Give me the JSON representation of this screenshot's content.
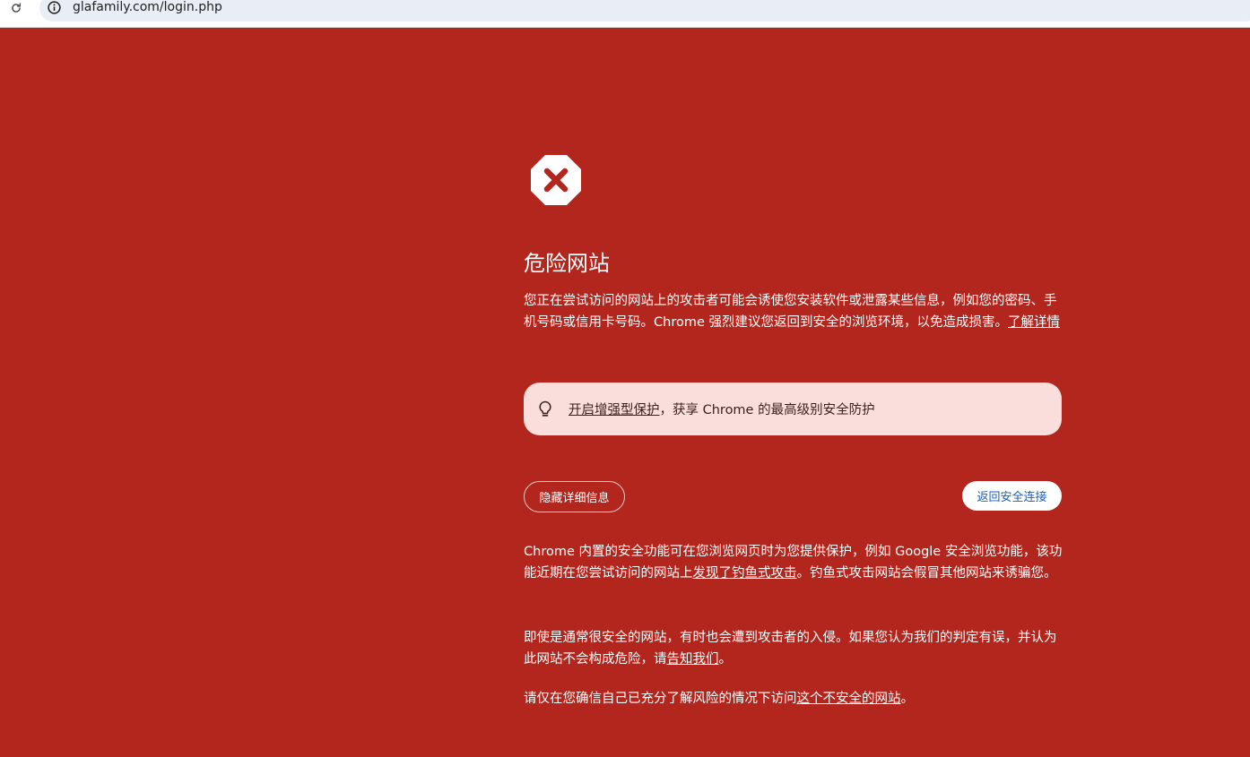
{
  "browser": {
    "url": "glafamily.com/login.php",
    "reload_icon": "reload-icon",
    "site_info_icon": "info-icon"
  },
  "warning": {
    "icon": "danger-octagon-x-icon",
    "title": "危险网站",
    "intro_prefix": "您正在尝试访问的网站上的攻击者可能会诱使您安装软件或泄露某些信息，例如您的密码、手机号码或信用卡号码。Chrome 强烈建议您返回到安全的浏览环境，以免造成损害。",
    "intro_link": "了解详情"
  },
  "promo": {
    "icon": "lightbulb-icon",
    "link": "开启增强型保护",
    "suffix": "，获享 Chrome 的最高级别安全防护"
  },
  "buttons": {
    "hide_details": "隐藏详细信息",
    "back_to_safety": "返回安全连接"
  },
  "details": {
    "p1_prefix": "Chrome 内置的安全功能可在您浏览网页时为您提供保护，例如 Google 安全浏览功能，该功能近期在您尝试访问的网站上",
    "p1_link": "发现了钓鱼式攻击",
    "p1_suffix": "。钓鱼式攻击网站会假冒其他网站来诱骗您。",
    "p2_prefix": "即使是通常很安全的网站，有时也会遭到攻击者的入侵。如果您认为我们的判定有误，并认为此网站不会构成危险，请",
    "p2_link": "告知我们",
    "p2_suffix": "。",
    "p3_prefix": "请仅在您确信自己已充分了解风险的情况下访问",
    "p3_link": "这个不安全的网站",
    "p3_suffix": "。"
  },
  "colors": {
    "background": "#b3261e",
    "promo_background": "#f9dedc",
    "back_button_text": "#1a5fb4"
  }
}
